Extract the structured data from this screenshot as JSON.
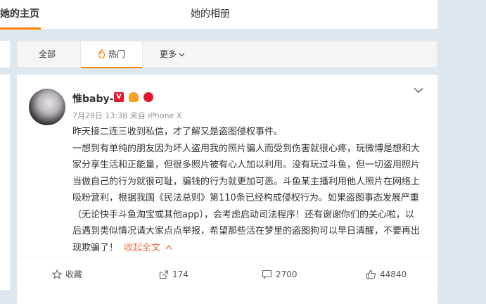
{
  "top_tabs": {
    "home": "她的主页",
    "album": "她的相册"
  },
  "filter": {
    "all": "全部",
    "hot": "热门",
    "more": "更多"
  },
  "post": {
    "username": "惟baby-",
    "date": "7月29日 13:38",
    "source": "来自 iPhone X",
    "paragraphs": [
      "昨天接二连三收到私信，才了解又是盗图侵权事件。",
      "一想到有单纯的朋友因为坏人盗用我的照片骗人而受到伤害就很心疼，玩微博是想和大家分享生活和正能量，但很多照片被有心人加以利用。没有玩过斗鱼，但一切盗用照片当做自己的行为就很可耻，骗钱的行为就更加可恶。斗鱼某主播利用他人照片在网络上吸粉营利，根据我国《民法总则》第110条已经构成侵权行为。如果盗图事态发展严重（无论快手斗鱼淘宝或其他app），会考虑启动司法程序！还有谢谢你们的关心啦，以后遇到类似情况请大家点点举报，希望那些活在梦里的盗图狗可以早日清醒，不要再出现欺骗了！"
    ],
    "collapse": "收起全文"
  },
  "actions": {
    "favorite": "收藏",
    "forward": "174",
    "comment": "2700",
    "like": "44840"
  },
  "colors": {
    "accent": "#ff8200",
    "link": "#eb7350",
    "badge_red": "#e6162d"
  }
}
